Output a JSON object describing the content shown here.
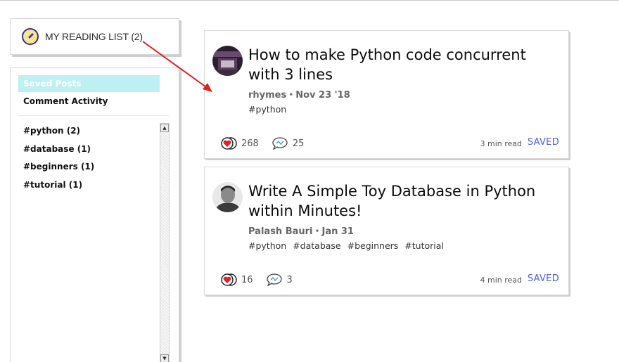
{
  "reading_list": {
    "title": "MY READING LIST (2)"
  },
  "sidebar": {
    "saved_posts": "Saved Posts",
    "comment_activity": "Comment Activity",
    "tags": [
      "#python (2)",
      "#database (1)",
      "#beginners (1)",
      "#tutorial (1)"
    ]
  },
  "posts": [
    {
      "title": "How to make Python code concurrent with 3 lines",
      "meta": "rhymes・Nov 23 '18",
      "tags": [
        "#python"
      ],
      "reactions": "268",
      "comments": "25",
      "read_time": "3 min read",
      "status": "SAVED"
    },
    {
      "title": "Write A Simple Toy Database in Python within Minutes!",
      "meta": "Palash Bauri・Jan 31",
      "tags": [
        "#python",
        "#database",
        "#beginners",
        "#tutorial"
      ],
      "reactions": "16",
      "comments": "3",
      "read_time": "4 min read",
      "status": "SAVED"
    }
  ],
  "colors": {
    "saved_link": "#4a5de8",
    "saved_posts_bg": "#bdf0f0",
    "arrow": "#e02020",
    "heart": "#e0202a"
  },
  "icons": {
    "reading_list": "pencil-icon",
    "reaction": "heart-icon",
    "comment": "comment-icon"
  }
}
